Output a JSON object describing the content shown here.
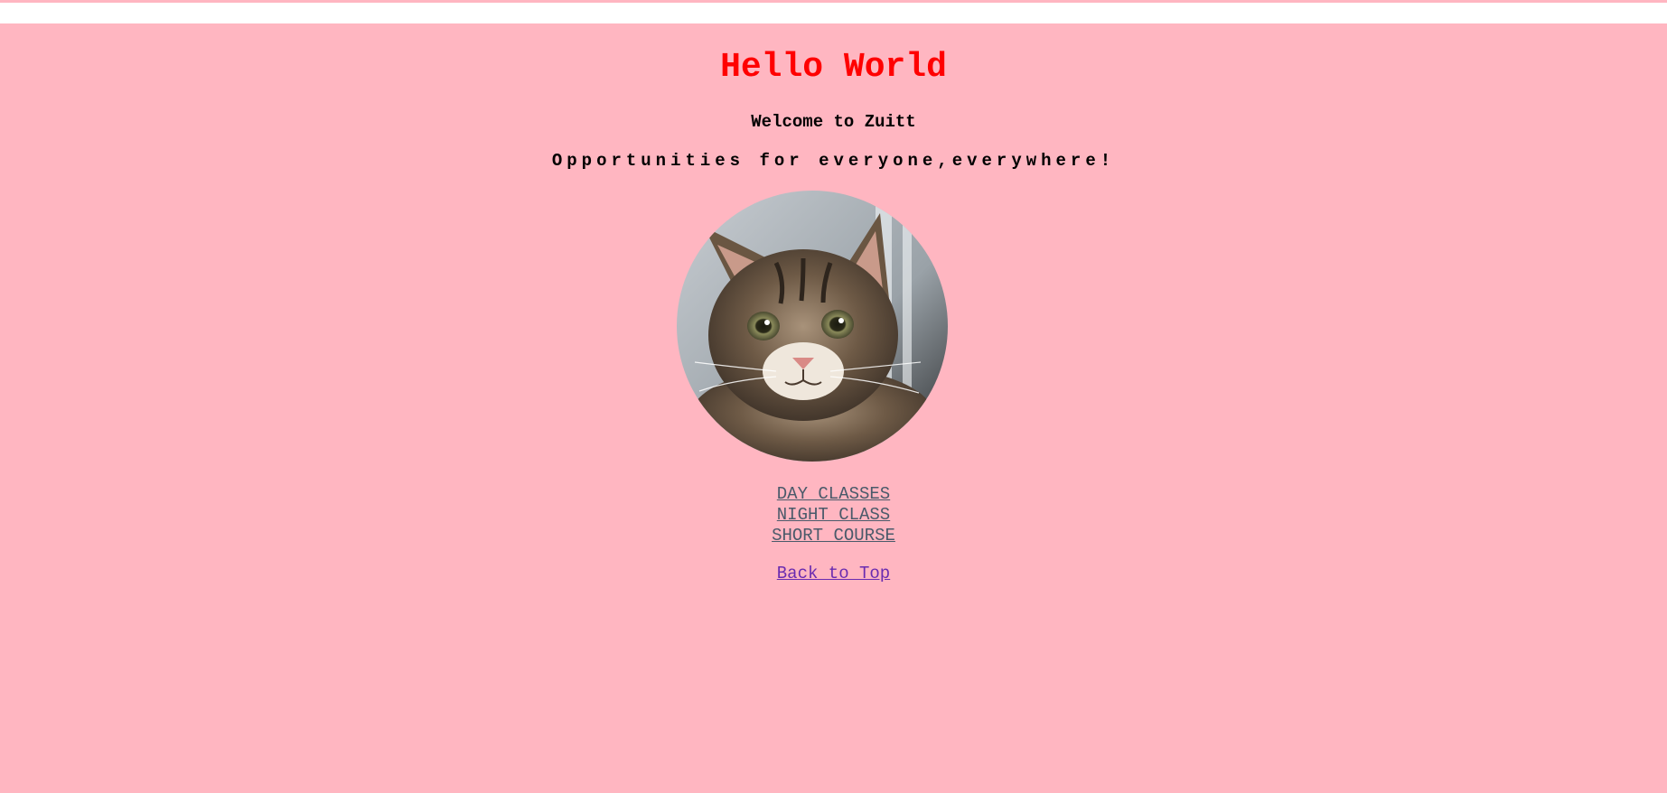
{
  "header": {
    "title": "Hello World",
    "welcome": "Welcome to Zuitt",
    "tagline": "Opportunities for everyone,everywhere!"
  },
  "image": {
    "subject": "cat"
  },
  "nav": {
    "links": [
      {
        "label": "DAY CLASSES"
      },
      {
        "label": "NIGHT CLASS"
      },
      {
        "label": "SHORT COURSE"
      }
    ]
  },
  "footer": {
    "back_to_top": "Back to Top"
  },
  "colors": {
    "page_background": "#ffb6c1",
    "title": "#ff0000",
    "link": "#4a5a6a",
    "visited_link": "#6a2bb0"
  }
}
